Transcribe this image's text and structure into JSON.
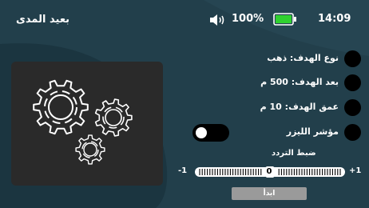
{
  "status_bar": {
    "title": "بعيد المدى",
    "battery_percent": "100%",
    "battery_level": 1.0,
    "time": "14:09",
    "icons": [
      "speaker-icon",
      "battery-icon"
    ],
    "battery_color": "#2fd12f"
  },
  "target_info": {
    "items": [
      {
        "label": "نوع الهدف: ذهب"
      },
      {
        "label": "بعد الهدف: 500 م"
      },
      {
        "label": "عمق الهدف: 10 م"
      },
      {
        "label": "مؤشر الليزر"
      }
    ]
  },
  "laser_toggle": {
    "on": false
  },
  "frequency_slider": {
    "label": "ضبط التردد",
    "min_label": "-1",
    "max_label": "+1",
    "value": "0"
  },
  "start_button": {
    "label": "ابدأ"
  },
  "image_panel": {
    "icon": "gears-icon"
  },
  "colors": {
    "background": "#223f4b",
    "swoosh": "#1b3540",
    "panel": "#2a2a2a",
    "button": "#9a9a9a"
  }
}
